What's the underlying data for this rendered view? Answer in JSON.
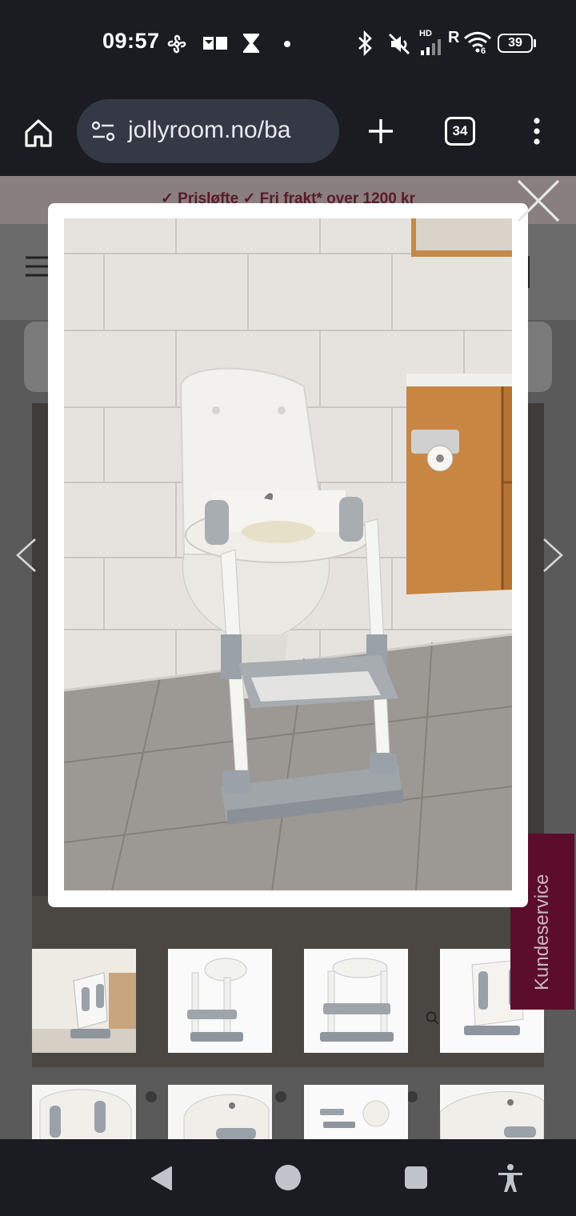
{
  "status_bar": {
    "time": "09:57",
    "battery": "39",
    "network": "R",
    "hd_label": "HD",
    "wifi_sub": "6",
    "icons": [
      "fan-icon",
      "notification-icon",
      "hourglass-icon",
      "dot-icon",
      "bluetooth-icon",
      "mute-icon",
      "signal-icon",
      "wifi-icon",
      "battery-icon"
    ]
  },
  "browser": {
    "url": "jollyroom.no/ba",
    "tab_count": "34",
    "icons": [
      "home-icon",
      "site-settings-icon",
      "new-tab-icon",
      "tabs-icon",
      "more-menu-icon"
    ]
  },
  "page": {
    "promo_text": "✓ Prisløfte   ✓ Fri frakt* over 1200 kr",
    "kundeservice": "Kundeservice",
    "thumbnails_row1": [
      "thumb-1",
      "thumb-2",
      "thumb-3",
      "thumb-4"
    ],
    "thumbnails_row2": [
      "thumb-5",
      "thumb-6",
      "thumb-7",
      "thumb-8"
    ]
  },
  "lightbox": {
    "image": "toilet-trainer-ladder-photo",
    "icons": [
      "close-icon",
      "chevron-left-icon",
      "chevron-right-icon"
    ]
  },
  "nav_bar": {
    "icons": [
      "back-icon",
      "home-circle-icon",
      "recents-icon",
      "accessibility-icon"
    ]
  },
  "colors": {
    "system_bg": "#1a1c22",
    "urlbar_bg": "#353945",
    "kundeservice_bg": "#5c0d2c",
    "modal_bg": "#ffffff"
  }
}
